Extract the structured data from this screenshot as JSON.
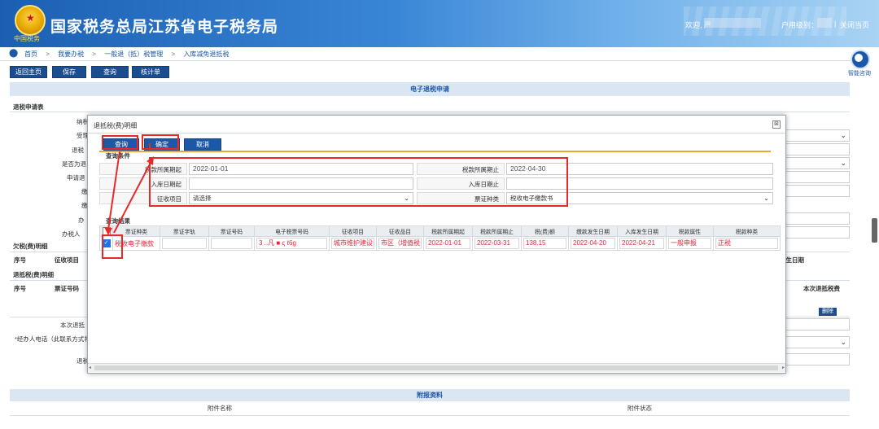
{
  "header": {
    "logo_subtext": "中国税务",
    "title": "国家税务总局江苏省电子税务局",
    "welcome": "欢迎, 严",
    "user_level": "户用级别：",
    "separator": "|",
    "close_page": "关闭当页"
  },
  "breadcrumb": {
    "items": [
      "首页",
      "我要办税",
      "一般退（抵）税管理",
      "入库减免退抵税"
    ],
    "arrow": ">"
  },
  "toolbar": {
    "return_home": "返回主页",
    "save": "保存",
    "query": "查询",
    "trial_calc": "核计单"
  },
  "assistant": {
    "label": "智能咨询"
  },
  "background": {
    "panel_title": "电子退税申请",
    "refund_form_title": "退税申请表",
    "labels": [
      "纳税",
      "受理",
      "退税",
      "是否为退",
      "申请退",
      "缴",
      "缴",
      "办",
      "办税人"
    ],
    "owed_tax_detail": "欠税(费)明细",
    "owed_cols": [
      "序号",
      "征收项目"
    ],
    "refund_detail": "退抵税(费)明细",
    "refund_cols": [
      "序号",
      "票证号码"
    ],
    "right_col_header": "本次退抵税费",
    "right_date_header": "发生日期",
    "delete_btn": "删除",
    "lower_labels": [
      "本次退抵",
      "*经办人电话（此联系方式将同",
      "退税"
    ],
    "attachments_title": "附报资料",
    "attachment_name_col": "附件名称",
    "attachment_status_col": "附件状态"
  },
  "modal": {
    "title": "退抵税(费)明细",
    "close_icon": "⊠",
    "buttons": {
      "query": "查询",
      "confirm": "确定",
      "cancel": "取消"
    },
    "query_section": "查询条件",
    "query_fields": {
      "tax_period_start_label": "税款所属期起",
      "tax_period_start_value": "2022-01-01",
      "tax_period_end_label": "税款所属期止",
      "tax_period_end_value": "2022-04-30",
      "storage_date_start_label": "入库日期起",
      "storage_date_start_value": "",
      "storage_date_end_label": "入库日期止",
      "storage_date_end_value": "",
      "levy_item_label": "征收项目",
      "levy_item_value": "请选择",
      "voucher_type_label": "票证种类",
      "voucher_type_value": "税收电子缴款书"
    },
    "result_section": "查询结果",
    "result_columns": [
      "",
      "票证种类",
      "票证字轨",
      "票证号码",
      "电子税票号码",
      "征收项目",
      "征收品目",
      "税款所属期起",
      "税款所属期止",
      "税(费)额",
      "缴款发生日期",
      "入库发生日期",
      "税款属性",
      "税款种类"
    ],
    "result_rows": [
      {
        "checked": true,
        "voucher_type": "税收电子缴款",
        "voucher_track": "",
        "voucher_number": "",
        "e_ticket_number": "3 ..凡 ■ ς ℓ6g",
        "levy_item": "城市维护建设",
        "levy_subitem": "市区（增值税",
        "period_start": "2022-01-01",
        "period_end": "2022-03-31",
        "amount": "138.15",
        "payment_date": "2022-04-20",
        "storage_date": "2022-04-21",
        "tax_attribute": "一般申报",
        "tax_category": "正税"
      }
    ]
  },
  "colors": {
    "header_blue": "#1b5fb3",
    "button_blue": "#1c4e8f",
    "highlight_red": "#e52a2a",
    "row_text_red": "#e6233a",
    "orange_rule": "#f0a23a"
  }
}
